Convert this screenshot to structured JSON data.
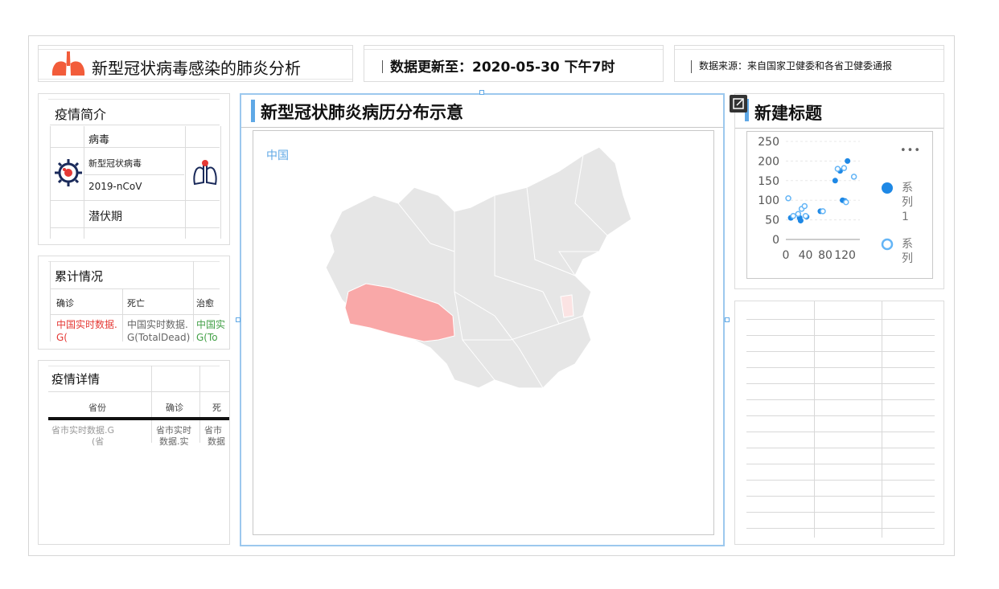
{
  "header": {
    "title": "新型冠状病毒感染的肺炎分析",
    "update_label": "数据更新至：2020-05-30 下午7时",
    "source_label": "数据来源：来自国家卫健委和各省卫健委通报"
  },
  "intro": {
    "title": "疫情简介",
    "virus_label": "病毒",
    "virus_name": "新型冠状病毒",
    "virus_code": "2019-nCoV",
    "incubation_label": "潜伏期"
  },
  "totals": {
    "title": "累计情况",
    "col_confirmed": "确诊",
    "col_death": "死亡",
    "col_cured": "治愈",
    "cell_confirmed": "中国实时数据.",
    "cell_confirmed_2": "G(",
    "cell_death": "中国实时数据.",
    "cell_death_2": "G(TotalDead)",
    "cell_cured": "中国实",
    "cell_cured_2": "G(To"
  },
  "details": {
    "title": "疫情详情",
    "col_province": "省份",
    "col_confirmed": "确诊",
    "col_death": "死",
    "cell_province": "省市实时数据.G",
    "cell_province_2": "(省",
    "cell_confirmed": "省市实时",
    "cell_confirmed_2": "数据.实",
    "cell_death": "省市",
    "cell_death_2": "数据"
  },
  "map_panel": {
    "title": "新型冠状肺炎病历分布示意",
    "region_label": "中国"
  },
  "scatter_panel": {
    "title": "新建标题",
    "more_label": "•••",
    "legend": [
      {
        "name": "系列1",
        "char1": "系",
        "char2": "列",
        "char3": "1",
        "color": "#1e88e5"
      },
      {
        "name": "系列",
        "char1": "系",
        "char2": "列",
        "color": "#64b5f6"
      }
    ]
  },
  "chart_data": {
    "type": "scatter",
    "xticks": [
      "0",
      "40",
      "80",
      "120"
    ],
    "yticks": [
      "250",
      "200",
      "150",
      "100",
      "50",
      "0"
    ],
    "xlim": [
      0,
      150
    ],
    "ylim": [
      0,
      250
    ],
    "series": [
      {
        "name": "系列1",
        "style": "filled",
        "color": "#1e88e5",
        "points": [
          [
            10,
            55
          ],
          [
            28,
            55
          ],
          [
            30,
            48
          ],
          [
            42,
            58
          ],
          [
            70,
            72
          ],
          [
            100,
            150
          ],
          [
            110,
            175
          ],
          [
            115,
            100
          ],
          [
            120,
            98
          ],
          [
            125,
            200
          ]
        ]
      },
      {
        "name": "系列",
        "style": "ring",
        "color": "#64b5f6",
        "points": [
          [
            5,
            105
          ],
          [
            15,
            60
          ],
          [
            25,
            65
          ],
          [
            32,
            78
          ],
          [
            38,
            85
          ],
          [
            40,
            60
          ],
          [
            75,
            72
          ],
          [
            105,
            180
          ],
          [
            118,
            182
          ],
          [
            122,
            95
          ],
          [
            138,
            160
          ]
        ]
      }
    ]
  },
  "colors": {
    "accent": "#5fa8e6",
    "tibet": "#f9a8a8",
    "province": "#e6e6e6",
    "highlight": "#fbe3e3",
    "confirmed_text": "#e53935",
    "cured_text": "#43a047"
  }
}
